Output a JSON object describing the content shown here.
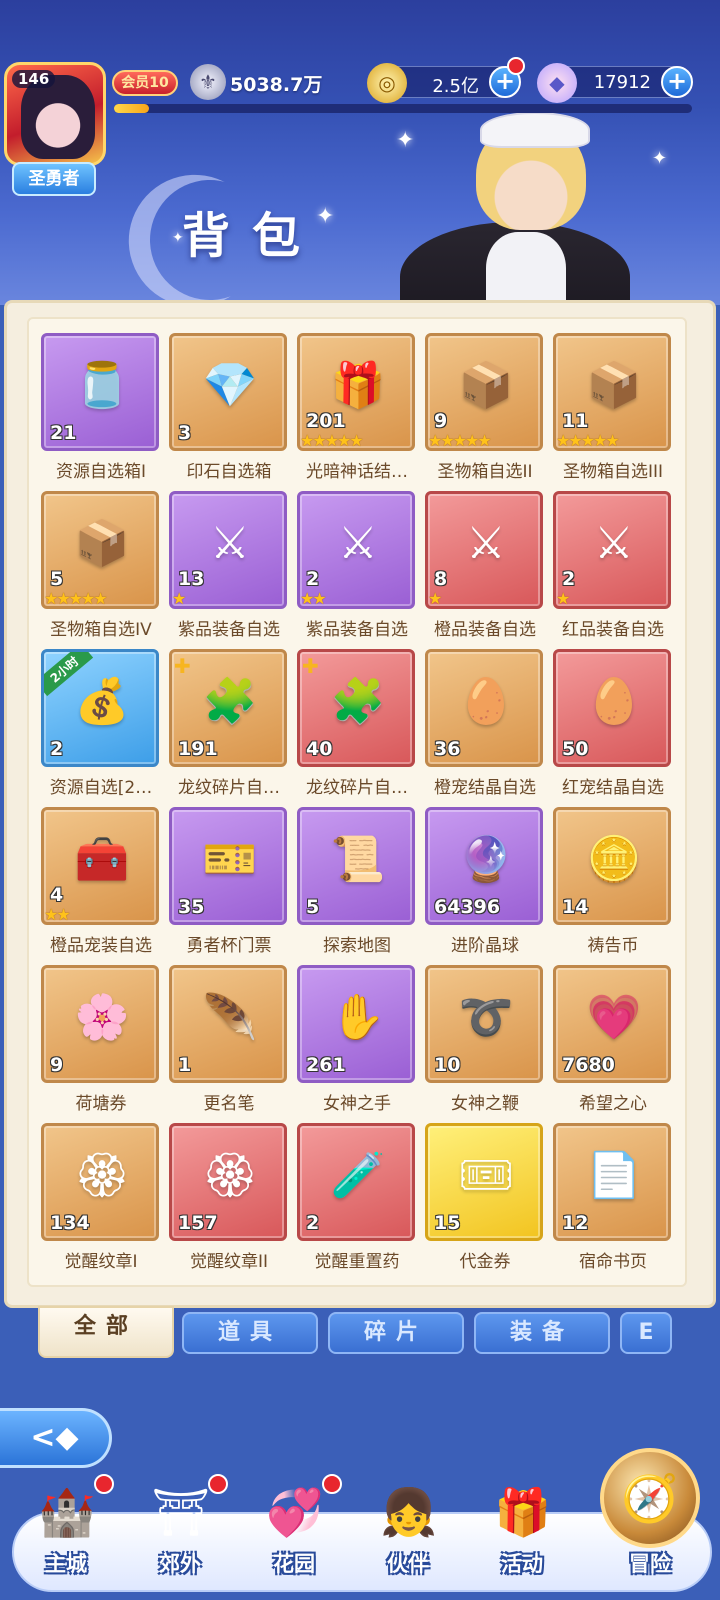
{
  "player": {
    "level": "146",
    "title": "圣勇者",
    "vip": "会员10",
    "power": "5038.7万",
    "exp_fraction": 0.06
  },
  "currencies": [
    {
      "icon": "gold-coin-icon",
      "value": "2.5亿",
      "has_notice": true
    },
    {
      "icon": "diamond-icon",
      "value": "17912",
      "has_notice": false
    }
  ],
  "page_title": "背包",
  "items": [
    {
      "name": "资源自选箱I",
      "qty": "21",
      "rarity": "purple",
      "art": "🫙",
      "stars": 0
    },
    {
      "name": "印石自选箱",
      "qty": "3",
      "rarity": "orange",
      "art": "💎",
      "stars": 0
    },
    {
      "name": "光暗神话结…",
      "qty": "201",
      "rarity": "orange",
      "art": "🎁",
      "stars": 5
    },
    {
      "name": "圣物箱自选II",
      "qty": "9",
      "rarity": "orange",
      "art": "📦",
      "stars": 5
    },
    {
      "name": "圣物箱自选III",
      "qty": "11",
      "rarity": "orange",
      "art": "📦",
      "stars": 5
    },
    {
      "name": "圣物箱自选IV",
      "qty": "5",
      "rarity": "orange",
      "art": "📦",
      "stars": 5
    },
    {
      "name": "紫品装备自选",
      "qty": "13",
      "rarity": "purple",
      "art": "⚔",
      "stars": 1
    },
    {
      "name": "紫品装备自选",
      "qty": "2",
      "rarity": "purple",
      "art": "⚔",
      "stars": 2
    },
    {
      "name": "橙品装备自选",
      "qty": "8",
      "rarity": "red",
      "art": "⚔",
      "stars": 1
    },
    {
      "name": "红品装备自选",
      "qty": "2",
      "rarity": "red",
      "art": "⚔",
      "stars": 1
    },
    {
      "name": "资源自选[2…",
      "qty": "2",
      "rarity": "blue",
      "art": "💰",
      "stars": 0,
      "tag": "2小时"
    },
    {
      "name": "龙纹碎片自…",
      "qty": "191",
      "rarity": "orange",
      "art": "🧩",
      "stars": 0,
      "puzzle": true
    },
    {
      "name": "龙纹碎片自…",
      "qty": "40",
      "rarity": "red",
      "art": "🧩",
      "stars": 0,
      "puzzle": true
    },
    {
      "name": "橙宠结晶自选",
      "qty": "36",
      "rarity": "orange",
      "art": "🥚",
      "stars": 0
    },
    {
      "name": "红宠结晶自选",
      "qty": "50",
      "rarity": "red",
      "art": "🥚",
      "stars": 0
    },
    {
      "name": "橙品宠装自选",
      "qty": "4",
      "rarity": "orange",
      "art": "🧰",
      "stars": 2
    },
    {
      "name": "勇者杯门票",
      "qty": "35",
      "rarity": "purple",
      "art": "🎫",
      "stars": 0
    },
    {
      "name": "探索地图",
      "qty": "5",
      "rarity": "purple",
      "art": "📜",
      "stars": 0
    },
    {
      "name": "进阶晶球",
      "qty": "64396",
      "rarity": "purple",
      "art": "🔮",
      "stars": 0
    },
    {
      "name": "祷告币",
      "qty": "14",
      "rarity": "orange",
      "art": "🪙",
      "stars": 0
    },
    {
      "name": "荷塘券",
      "qty": "9",
      "rarity": "orange",
      "art": "🌸",
      "stars": 0
    },
    {
      "name": "更名笔",
      "qty": "1",
      "rarity": "orange",
      "art": "🪶",
      "stars": 0
    },
    {
      "name": "女神之手",
      "qty": "261",
      "rarity": "purple",
      "art": "✋",
      "stars": 0
    },
    {
      "name": "女神之鞭",
      "qty": "10",
      "rarity": "orange",
      "art": "➰",
      "stars": 0
    },
    {
      "name": "希望之心",
      "qty": "7680",
      "rarity": "orange",
      "art": "💗",
      "stars": 0
    },
    {
      "name": "觉醒纹章I",
      "qty": "134",
      "rarity": "orange",
      "art": "🏵",
      "stars": 0
    },
    {
      "name": "觉醒纹章II",
      "qty": "157",
      "rarity": "red",
      "art": "🏵",
      "stars": 0
    },
    {
      "name": "觉醒重置药",
      "qty": "2",
      "rarity": "red",
      "art": "🧪",
      "stars": 0
    },
    {
      "name": "代金券",
      "qty": "15",
      "rarity": "gold",
      "art": "🎟",
      "stars": 0
    },
    {
      "name": "宿命书页",
      "qty": "12",
      "rarity": "orange",
      "art": "📄",
      "stars": 0
    }
  ],
  "tabs": [
    {
      "label": "全部",
      "active": true
    },
    {
      "label": "道具",
      "active": false
    },
    {
      "label": "碎片",
      "active": false
    },
    {
      "label": "装备",
      "active": false
    },
    {
      "label": "E",
      "active": false
    }
  ],
  "back_button": "<◆",
  "nav": [
    {
      "label": "主城",
      "icon": "castle-icon",
      "glyph": "🏰",
      "has_notice": true
    },
    {
      "label": "郊外",
      "icon": "gate-icon",
      "glyph": "⛩",
      "has_notice": true
    },
    {
      "label": "花园",
      "icon": "heart-garden-icon",
      "glyph": "💞",
      "has_notice": true
    },
    {
      "label": "伙伴",
      "icon": "partner-icon",
      "glyph": "👧",
      "has_notice": false
    },
    {
      "label": "活动",
      "icon": "gift-icon",
      "glyph": "🎁",
      "has_notice": false
    }
  ],
  "adventure": {
    "label": "冒险",
    "glyph": "🧭"
  }
}
